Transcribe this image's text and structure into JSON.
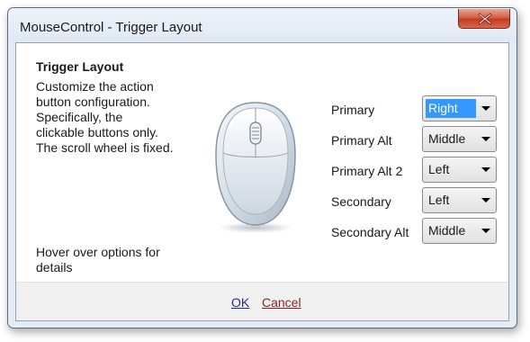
{
  "window": {
    "title": "MouseControl - Trigger Layout"
  },
  "content": {
    "heading": "Trigger Layout",
    "description": [
      "Customize the action",
      "button configuration.",
      "Specifically, the",
      "clickable buttons only.",
      "The scroll wheel is fixed."
    ],
    "hint": [
      "Hover over options for",
      "details"
    ]
  },
  "triggers": [
    {
      "label": "Primary",
      "value": "Right",
      "focused": true
    },
    {
      "label": "Primary Alt",
      "value": "Middle",
      "focused": false
    },
    {
      "label": "Primary Alt 2",
      "value": "Left",
      "focused": false
    },
    {
      "label": "Secondary",
      "value": "Left",
      "focused": false
    },
    {
      "label": "Secondary Alt",
      "value": "Middle",
      "focused": false
    }
  ],
  "footer": {
    "ok_label": "OK",
    "cancel_label": "Cancel"
  },
  "icons": {
    "close": "close-icon",
    "mouse": "mouse-icon",
    "dropdown": "chevron-down-icon"
  },
  "colors": {
    "selection": "#3399ff",
    "close_button": "#c9452a"
  }
}
